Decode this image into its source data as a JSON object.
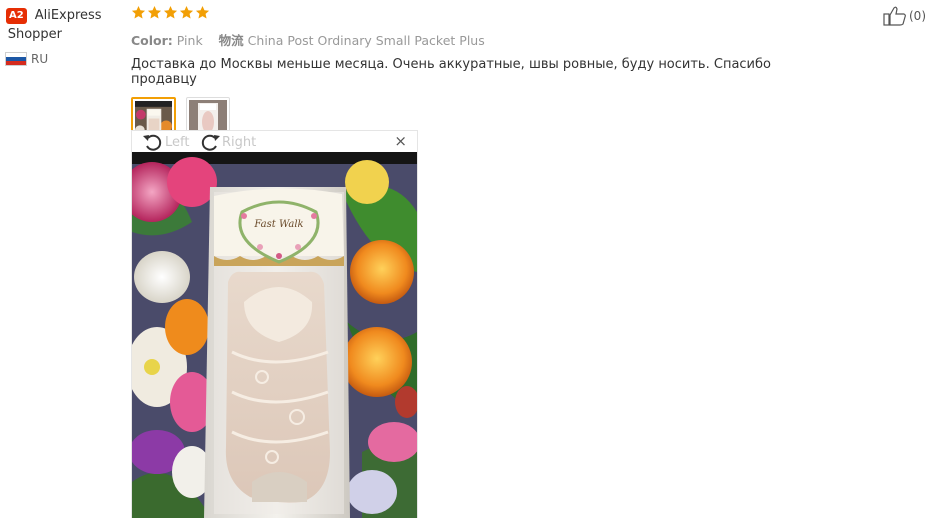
{
  "reviewer": {
    "badge": "A2",
    "name_first": "AliExpress",
    "name_rest": "Shopper",
    "country_code": "RU",
    "flag_colors": [
      "#ffffff",
      "#1c57a5",
      "#d52b1e"
    ]
  },
  "review": {
    "rating": 5,
    "star_color": "#f29f05",
    "color_label": "Color:",
    "color_value": "Pink",
    "logistics_label": "物流",
    "logistics_value": "China Post Ordinary Small Packet Plus",
    "text": "Доставка до Москвы меньше месяца. Очень аккуратные, швы ровные, буду носить. Спасибо продавцу"
  },
  "thumbnails": [
    {
      "name": "review-photo-1",
      "active": true
    },
    {
      "name": "review-photo-2",
      "active": false
    }
  ],
  "viewer": {
    "rotate_left_label": "Left",
    "rotate_right_label": "Right",
    "close_label": "×",
    "photo_package_text": "Fast Walk"
  },
  "like": {
    "count_label": "(0)",
    "icon": "thumbs-up-icon"
  },
  "colors": {
    "accent": "#f29f05",
    "badge": "#e62e04"
  }
}
